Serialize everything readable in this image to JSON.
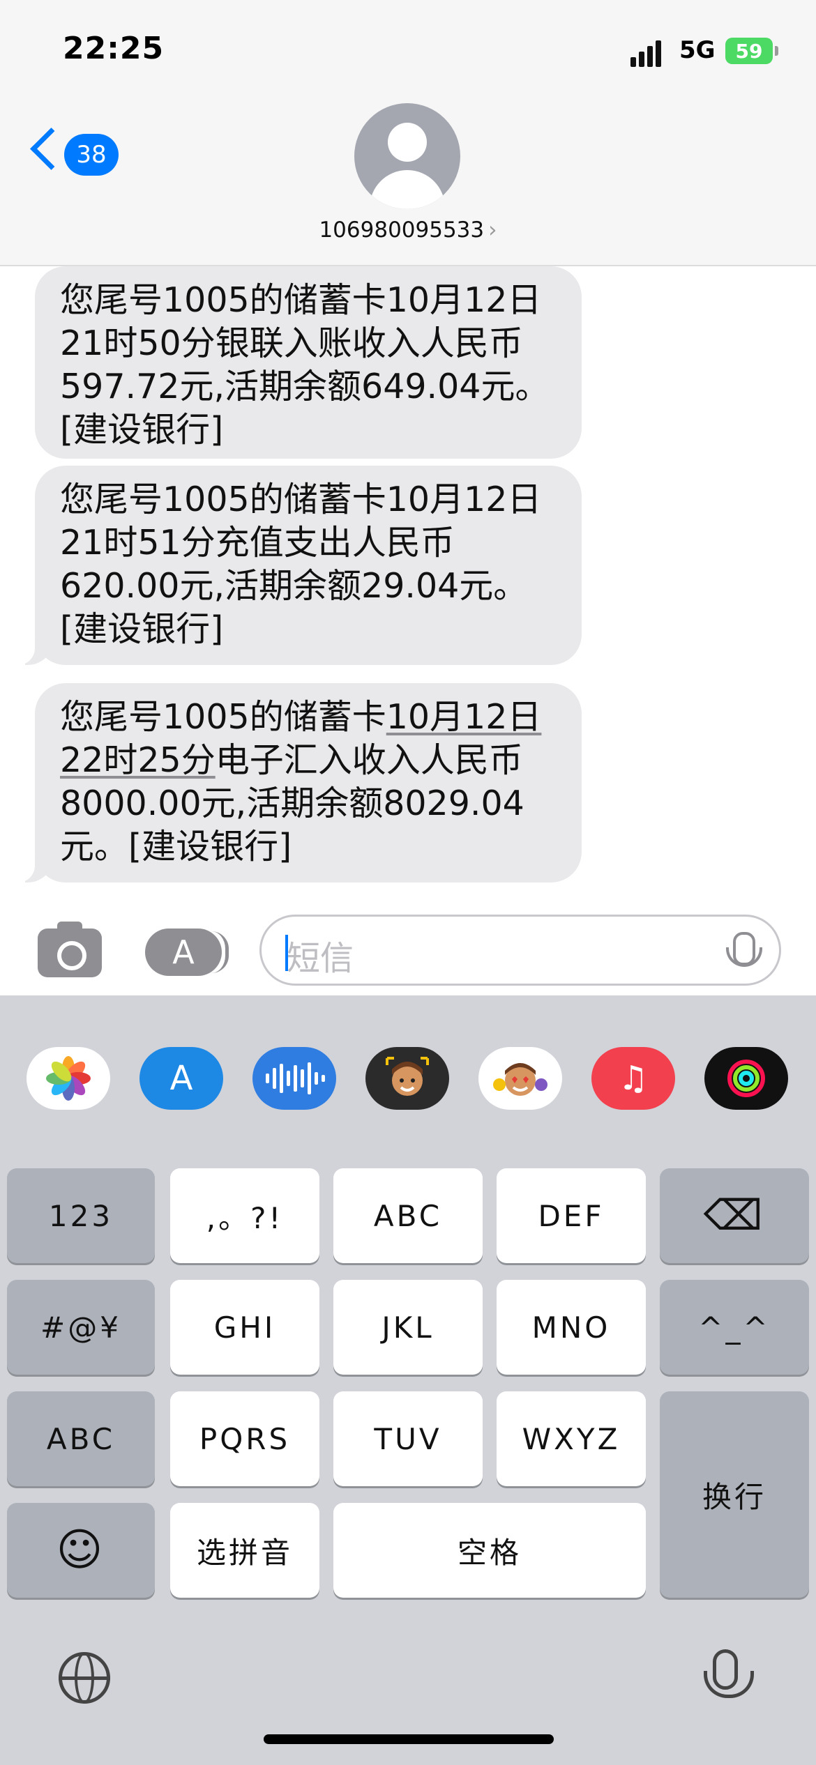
{
  "status_bar": {
    "time": "22:25",
    "network": "5G",
    "battery": "59"
  },
  "nav": {
    "back_badge": "38",
    "contact": "106980095533",
    "contact_chevron": "›"
  },
  "messages": [
    {
      "text": "您尾号1005的储蓄卡10月12日21时50分银联入账收入人民币597.72元,活期余额649.04元。[建设银行]"
    },
    {
      "text": "您尾号1005的储蓄卡10月12日21时51分充值支出人民币620.00元,活期余额29.04元。[建设银行]"
    },
    {
      "line1a": "您尾号1005的储蓄卡",
      "line1b": "10月12日",
      "line2a": "22时25分",
      "line2b": "电子汇入收入人民币",
      "rest": "8000.00元,活期余额8029.04元。[建设银行]"
    }
  ],
  "input": {
    "placeholder": "短信"
  },
  "app_strip": [
    "photos-icon",
    "app-store-icon",
    "audio-icon",
    "memoji-icon",
    "memoji-stickers-icon",
    "music-icon",
    "activity-icon"
  ],
  "keyboard": {
    "row1": [
      "123",
      ",。?!",
      "ABC",
      "DEF",
      "⌫"
    ],
    "row2": [
      "#@¥",
      "GHI",
      "JKL",
      "MNO",
      "^_^"
    ],
    "row3": [
      "ABC",
      "PQRS",
      "TUV",
      "WXYZ"
    ],
    "row4": [
      "☺",
      "选拼音",
      "空格"
    ],
    "return": "换行"
  }
}
